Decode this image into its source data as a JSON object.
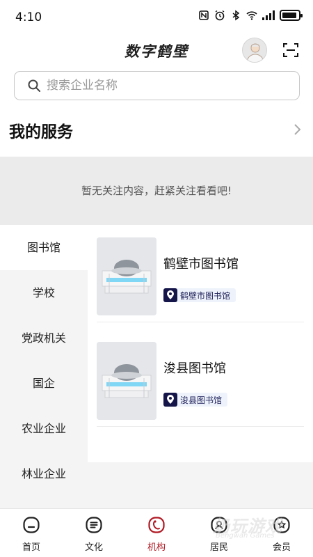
{
  "status_bar": {
    "time": "4:10",
    "battery_level": 0.9
  },
  "header": {
    "title": "数字鹤壁"
  },
  "search": {
    "placeholder": "搜索企业名称"
  },
  "services": {
    "title": "我的服务",
    "empty_message": "暂无关注内容，赶紧关注看看吧!"
  },
  "categories": [
    {
      "label": "图书馆",
      "active": true
    },
    {
      "label": "学校",
      "active": false
    },
    {
      "label": "党政机关",
      "active": false
    },
    {
      "label": "国企",
      "active": false
    },
    {
      "label": "农业企业",
      "active": false
    },
    {
      "label": "林业企业",
      "active": false
    }
  ],
  "institutions": [
    {
      "name": "鹤壁市图书馆",
      "tag": "鹤壁市图书馆"
    },
    {
      "name": "浚县图书馆",
      "tag": "浚县图书馆"
    }
  ],
  "bottom_nav": [
    {
      "label": "首页",
      "icon": "home-icon",
      "active": false
    },
    {
      "label": "文化",
      "icon": "culture-icon",
      "active": false
    },
    {
      "label": "机构",
      "icon": "institution-icon",
      "active": true
    },
    {
      "label": "居民",
      "icon": "resident-icon",
      "active": false
    },
    {
      "label": "会员",
      "icon": "member-icon",
      "active": false
    }
  ],
  "watermark": {
    "main": "奶玩游戏",
    "sub": "Bengwan Games"
  },
  "colors": {
    "accent": "#b01822",
    "tag_bg": "#eef3fb",
    "pin_bg": "#15154a",
    "empty_bg": "#ebebeb"
  }
}
